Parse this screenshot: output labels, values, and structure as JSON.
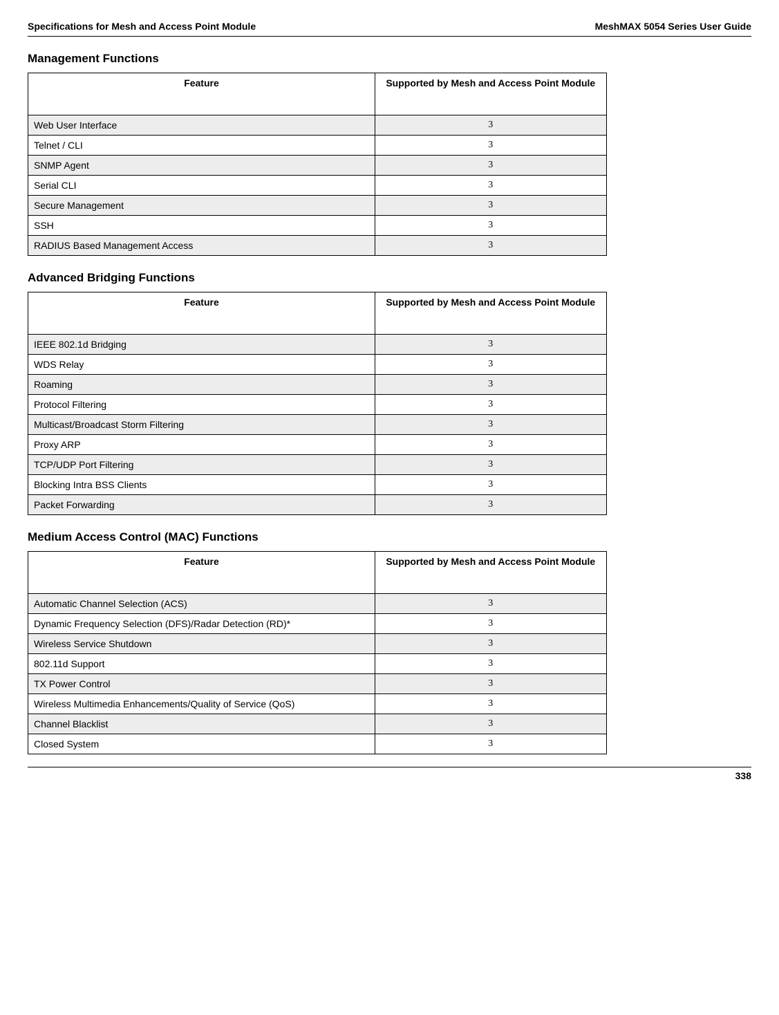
{
  "header": {
    "left": "Specifications for Mesh and Access Point Module",
    "right": "MeshMAX 5054 Series User Guide"
  },
  "footer": {
    "page": "338"
  },
  "columns": {
    "feature": "Feature",
    "support": "Supported by Mesh and Access Point Module"
  },
  "sections": [
    {
      "title": "Management Functions",
      "rows": [
        {
          "f": "Web User Interface",
          "s": "3"
        },
        {
          "f": "Telnet / CLI",
          "s": "3"
        },
        {
          "f": "SNMP Agent",
          "s": "3"
        },
        {
          "f": "Serial CLI",
          "s": "3"
        },
        {
          "f": "Secure Management",
          "s": "3"
        },
        {
          "f": "SSH",
          "s": "3"
        },
        {
          "f": "RADIUS Based Management Access",
          "s": "3"
        }
      ]
    },
    {
      "title": "Advanced Bridging Functions",
      "rows": [
        {
          "f": "IEEE 802.1d Bridging",
          "s": "3"
        },
        {
          "f": "WDS Relay",
          "s": "3"
        },
        {
          "f": "Roaming",
          "s": "3"
        },
        {
          "f": "Protocol Filtering",
          "s": "3"
        },
        {
          "f": "Multicast/Broadcast Storm Filtering",
          "s": "3"
        },
        {
          "f": "Proxy ARP",
          "s": "3"
        },
        {
          "f": "TCP/UDP Port Filtering",
          "s": "3"
        },
        {
          "f": "Blocking Intra BSS Clients",
          "s": "3"
        },
        {
          "f": "Packet Forwarding",
          "s": "3"
        }
      ]
    },
    {
      "title": "Medium Access Control (MAC) Functions",
      "rows": [
        {
          "f": "Automatic Channel Selection (ACS)",
          "s": "3"
        },
        {
          "f": "Dynamic Frequency Selection (DFS)/Radar Detection (RD)*",
          "s": "3"
        },
        {
          "f": "Wireless Service Shutdown",
          "s": "3"
        },
        {
          "f": "802.11d Support",
          "s": "3"
        },
        {
          "f": "TX Power Control",
          "s": "3"
        },
        {
          "f": "Wireless Multimedia Enhancements/Quality of Service (QoS)",
          "s": "3"
        },
        {
          "f": "Channel Blacklist",
          "s": "3"
        },
        {
          "f": "Closed System",
          "s": "3"
        }
      ]
    }
  ]
}
